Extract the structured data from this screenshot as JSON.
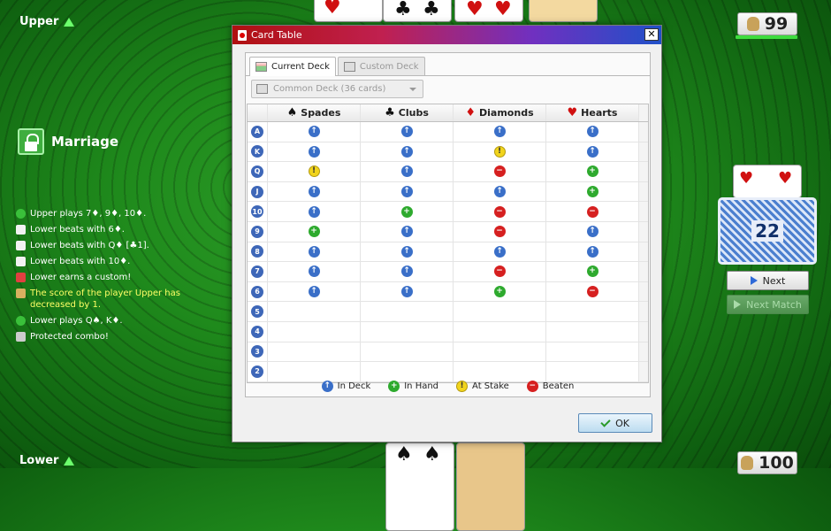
{
  "players": {
    "upper": {
      "name": "Upper",
      "score": "99"
    },
    "lower": {
      "name": "Lower",
      "score": "100"
    }
  },
  "combo": {
    "label": "Marriage"
  },
  "log": [
    {
      "icon": "check-icon",
      "text": "Upper plays 7♦, 9♦, 10♦.",
      "highlight": false
    },
    {
      "icon": "cards-icon",
      "text": "Lower beats with 6♦.",
      "highlight": false
    },
    {
      "icon": "cards-icon",
      "text": "Lower beats with Q♦ [♣1].",
      "highlight": false
    },
    {
      "icon": "cards-icon",
      "text": "Lower beats with 10♦.",
      "highlight": false
    },
    {
      "icon": "gem-icon",
      "text": "Lower earns a custom!",
      "highlight": false
    },
    {
      "icon": "money-bag-icon",
      "text": "The score of the player Upper has decreased by 1.",
      "highlight": true
    },
    {
      "icon": "check-icon",
      "text": "Lower plays Q♠, K♦.",
      "highlight": false
    },
    {
      "icon": "shield-icon",
      "text": "Protected combo!",
      "highlight": false
    }
  ],
  "deck_count": "22",
  "buttons": {
    "next": "Next",
    "next_match": "Next Match",
    "ok": "OK"
  },
  "dialog": {
    "title": "Card Table",
    "tabs": [
      "Current Deck",
      "Custom Deck"
    ],
    "deck_select": "Common Deck (36 cards)",
    "columns": [
      {
        "label": "Spades",
        "symbol": "♠",
        "color": "#111111"
      },
      {
        "label": "Clubs",
        "symbol": "♣",
        "color": "#111111"
      },
      {
        "label": "Diamonds",
        "symbol": "♦",
        "color": "#d01010"
      },
      {
        "label": "Hearts",
        "symbol": "♥",
        "color": "#d01010"
      }
    ],
    "rows": [
      {
        "rank": "A",
        "states": [
          "deck",
          "deck",
          "deck",
          "deck"
        ]
      },
      {
        "rank": "K",
        "states": [
          "deck",
          "deck",
          "stake",
          "deck"
        ]
      },
      {
        "rank": "Q",
        "states": [
          "stake",
          "deck",
          "beaten",
          "hand"
        ]
      },
      {
        "rank": "J",
        "states": [
          "deck",
          "deck",
          "deck",
          "hand"
        ]
      },
      {
        "rank": "10",
        "states": [
          "deck",
          "hand",
          "beaten",
          "beaten"
        ]
      },
      {
        "rank": "9",
        "states": [
          "hand",
          "deck",
          "beaten",
          "deck"
        ]
      },
      {
        "rank": "8",
        "states": [
          "deck",
          "deck",
          "deck",
          "deck"
        ]
      },
      {
        "rank": "7",
        "states": [
          "deck",
          "deck",
          "beaten",
          "hand"
        ]
      },
      {
        "rank": "6",
        "states": [
          "deck",
          "deck",
          "hand",
          "beaten"
        ]
      },
      {
        "rank": "5",
        "states": [
          "",
          "",
          "",
          ""
        ]
      },
      {
        "rank": "4",
        "states": [
          "",
          "",
          "",
          ""
        ]
      },
      {
        "rank": "3",
        "states": [
          "",
          "",
          "",
          ""
        ]
      },
      {
        "rank": "2",
        "states": [
          "",
          "",
          "",
          ""
        ]
      }
    ],
    "legend": [
      {
        "state": "deck",
        "label": "In Deck"
      },
      {
        "state": "hand",
        "label": "In Hand"
      },
      {
        "state": "stake",
        "label": "At Stake"
      },
      {
        "state": "beaten",
        "label": "Beaten"
      }
    ]
  }
}
